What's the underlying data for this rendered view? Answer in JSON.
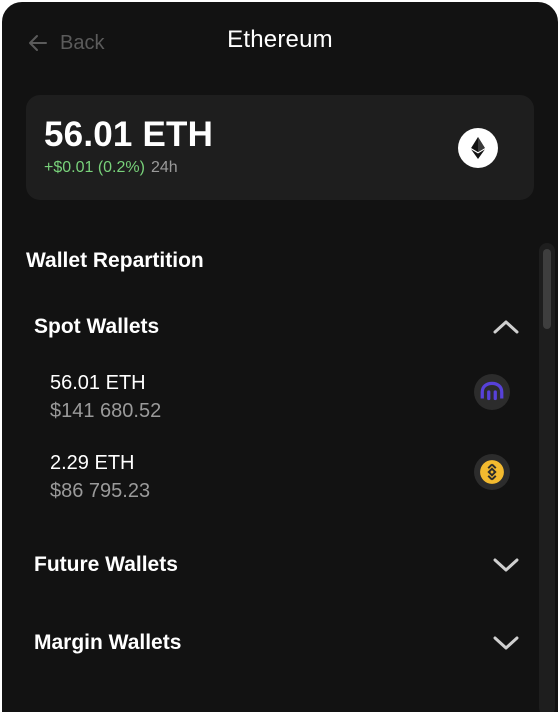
{
  "header": {
    "back_label": "Back",
    "title": "Ethereum"
  },
  "balance": {
    "amount": "56.01 ETH",
    "change": "+$0.01 (0.2%)",
    "period": "24h",
    "token_icon": "ethereum-icon"
  },
  "repartition": {
    "title": "Wallet Repartition",
    "groups": [
      {
        "label": "Spot Wallets",
        "expanded": true,
        "wallets": [
          {
            "amount": "56.01 ETH",
            "value": "$141 680.52",
            "exchange_icon": "kraken-icon"
          },
          {
            "amount": "2.29 ETH",
            "value": "$86 795.23",
            "exchange_icon": "binance-icon"
          }
        ]
      },
      {
        "label": "Future Wallets",
        "expanded": false
      },
      {
        "label": "Margin Wallets",
        "expanded": false
      }
    ]
  },
  "colors": {
    "background": "#121212",
    "card": "#1e1e1e",
    "positive": "#78d17a",
    "muted": "#9a9a9a",
    "kraken": "#5741d9",
    "binance": "#f3ba2f"
  }
}
